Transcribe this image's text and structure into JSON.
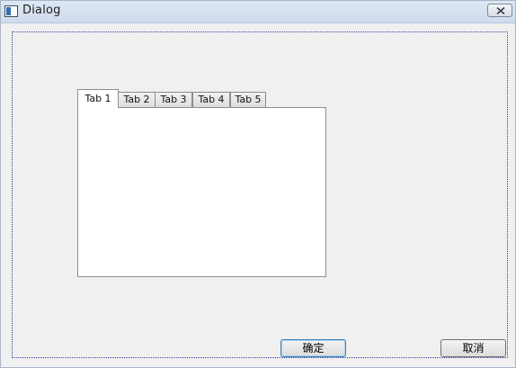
{
  "window": {
    "title": "Dialog"
  },
  "tabs": [
    {
      "label": "Tab 1",
      "active": true
    },
    {
      "label": "Tab 2",
      "active": false
    },
    {
      "label": "Tab 3",
      "active": false
    },
    {
      "label": "Tab 4",
      "active": false
    },
    {
      "label": "Tab 5",
      "active": false
    }
  ],
  "buttons": {
    "ok_label": "确定",
    "cancel_label": "取消"
  },
  "icons": {
    "app": "window-app-icon",
    "close": "close-icon"
  }
}
